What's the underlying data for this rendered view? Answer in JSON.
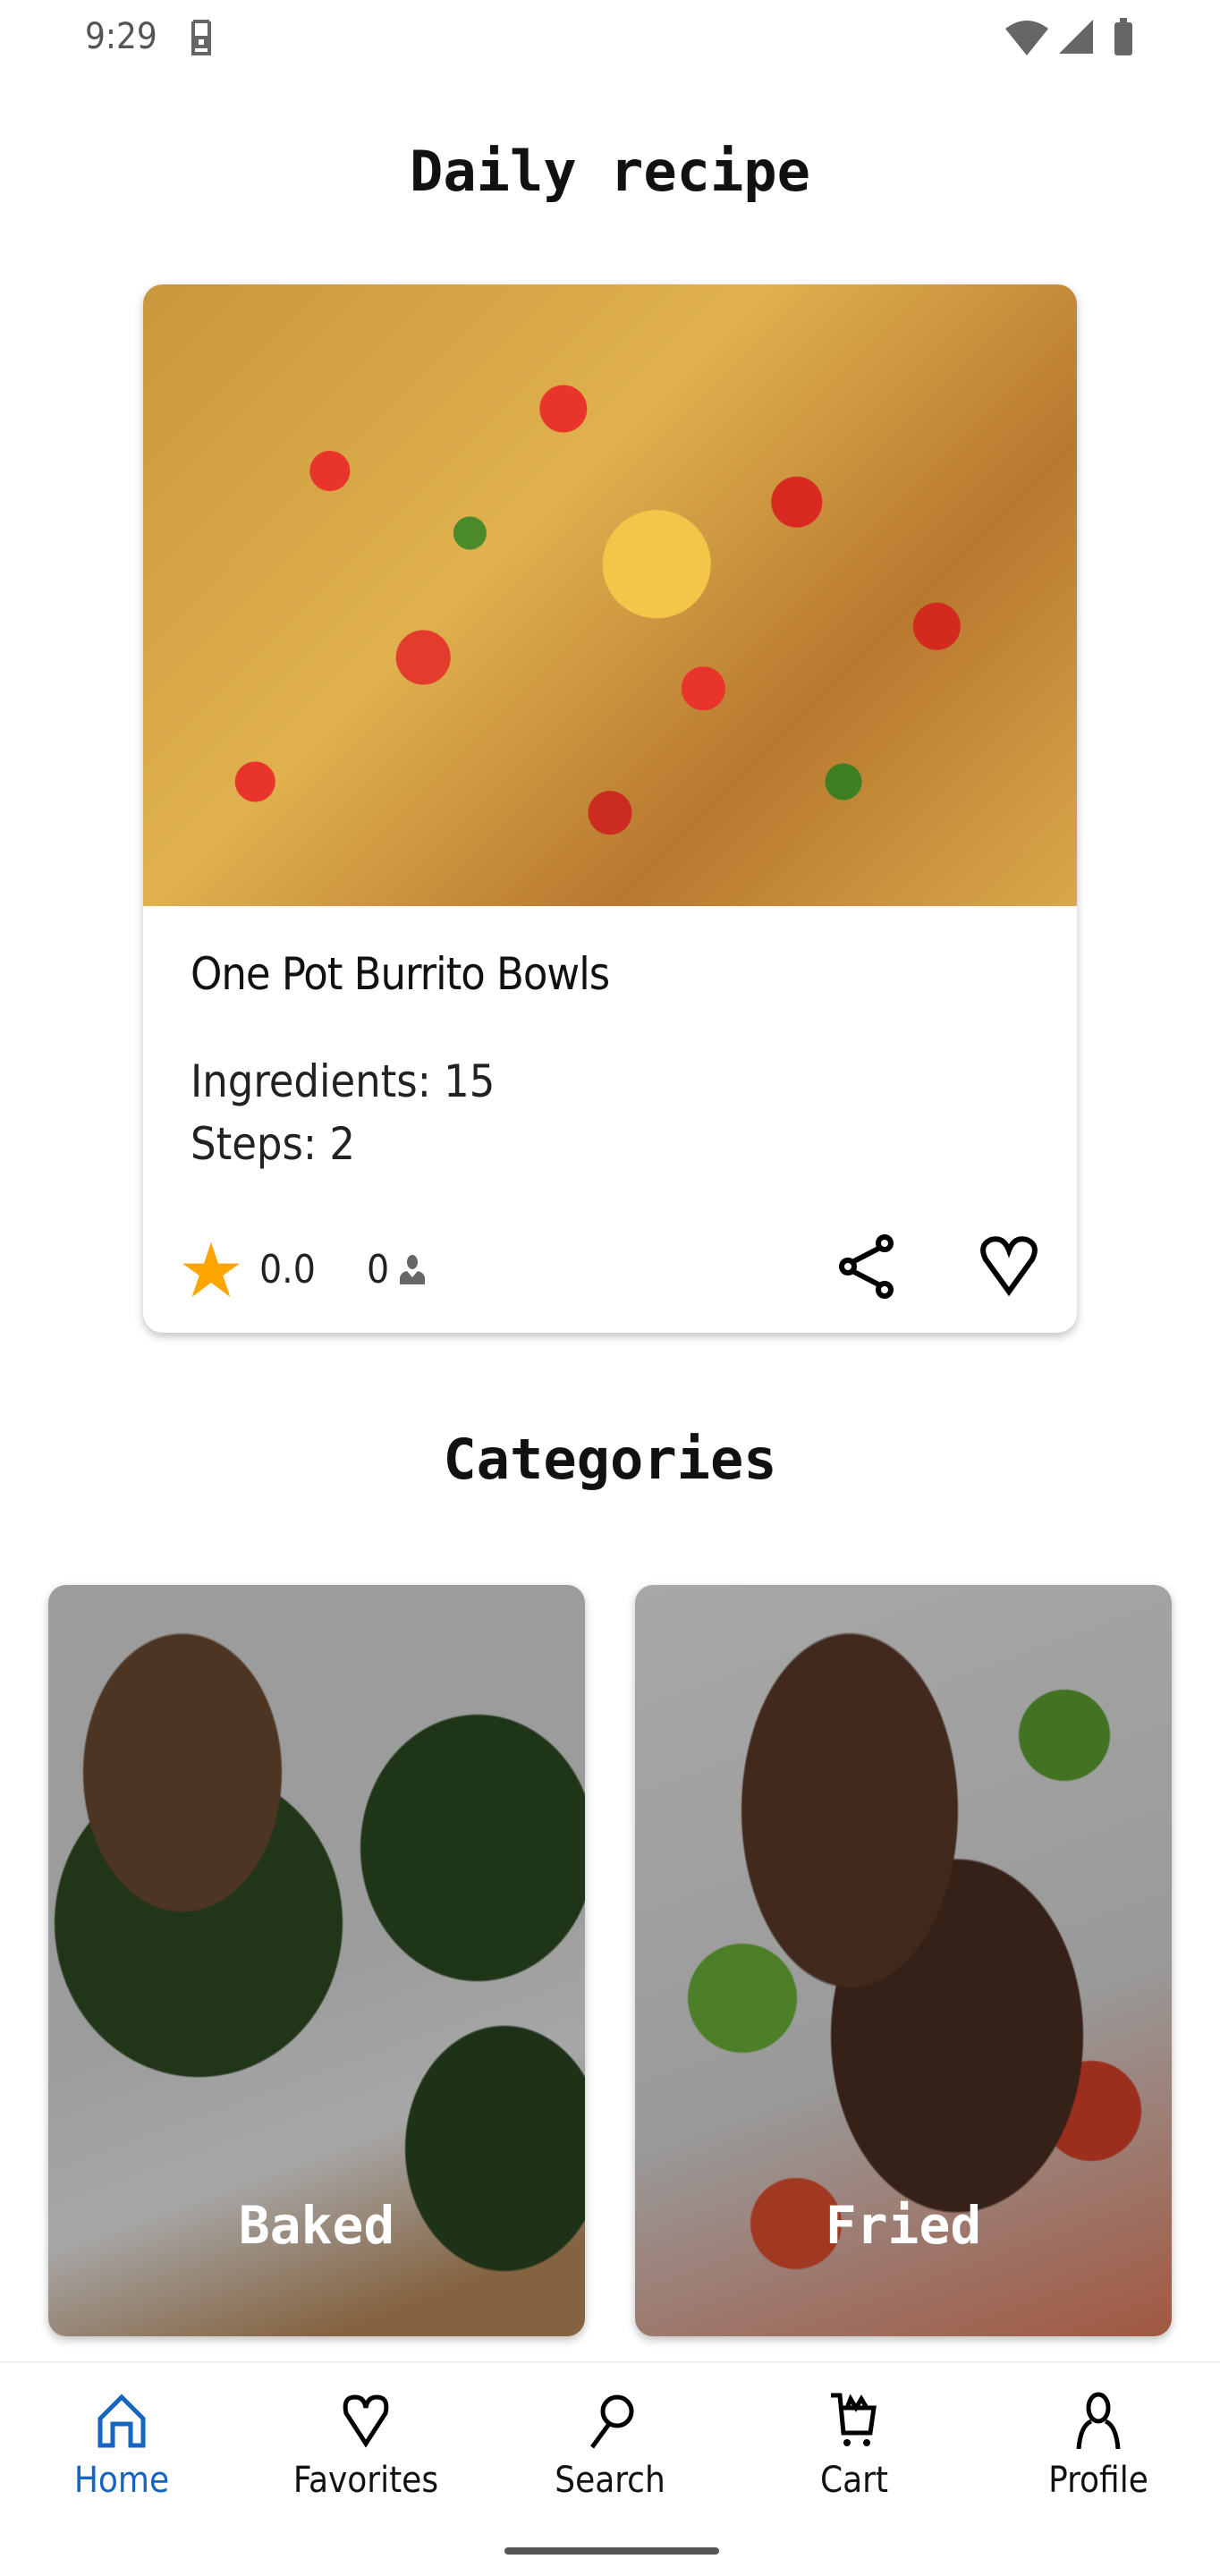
{
  "status_bar": {
    "time": "9:29"
  },
  "daily": {
    "heading": "Daily recipe",
    "recipe": {
      "title": "One Pot Burrito Bowls",
      "ingredients": "Ingredients: 15",
      "steps": "Steps: 2",
      "rating": "0.0",
      "reviews": "0"
    }
  },
  "categories": {
    "heading": "Categories",
    "items": [
      {
        "label": "Baked"
      },
      {
        "label": "Fried"
      }
    ]
  },
  "nav": {
    "active": "Home",
    "accent": "#1565c0",
    "items": [
      {
        "label": "Home",
        "icon": "home-icon"
      },
      {
        "label": "Favorites",
        "icon": "heart-icon"
      },
      {
        "label": "Search",
        "icon": "search-icon"
      },
      {
        "label": "Cart",
        "icon": "cart-icon"
      },
      {
        "label": "Profile",
        "icon": "person-icon"
      }
    ]
  }
}
